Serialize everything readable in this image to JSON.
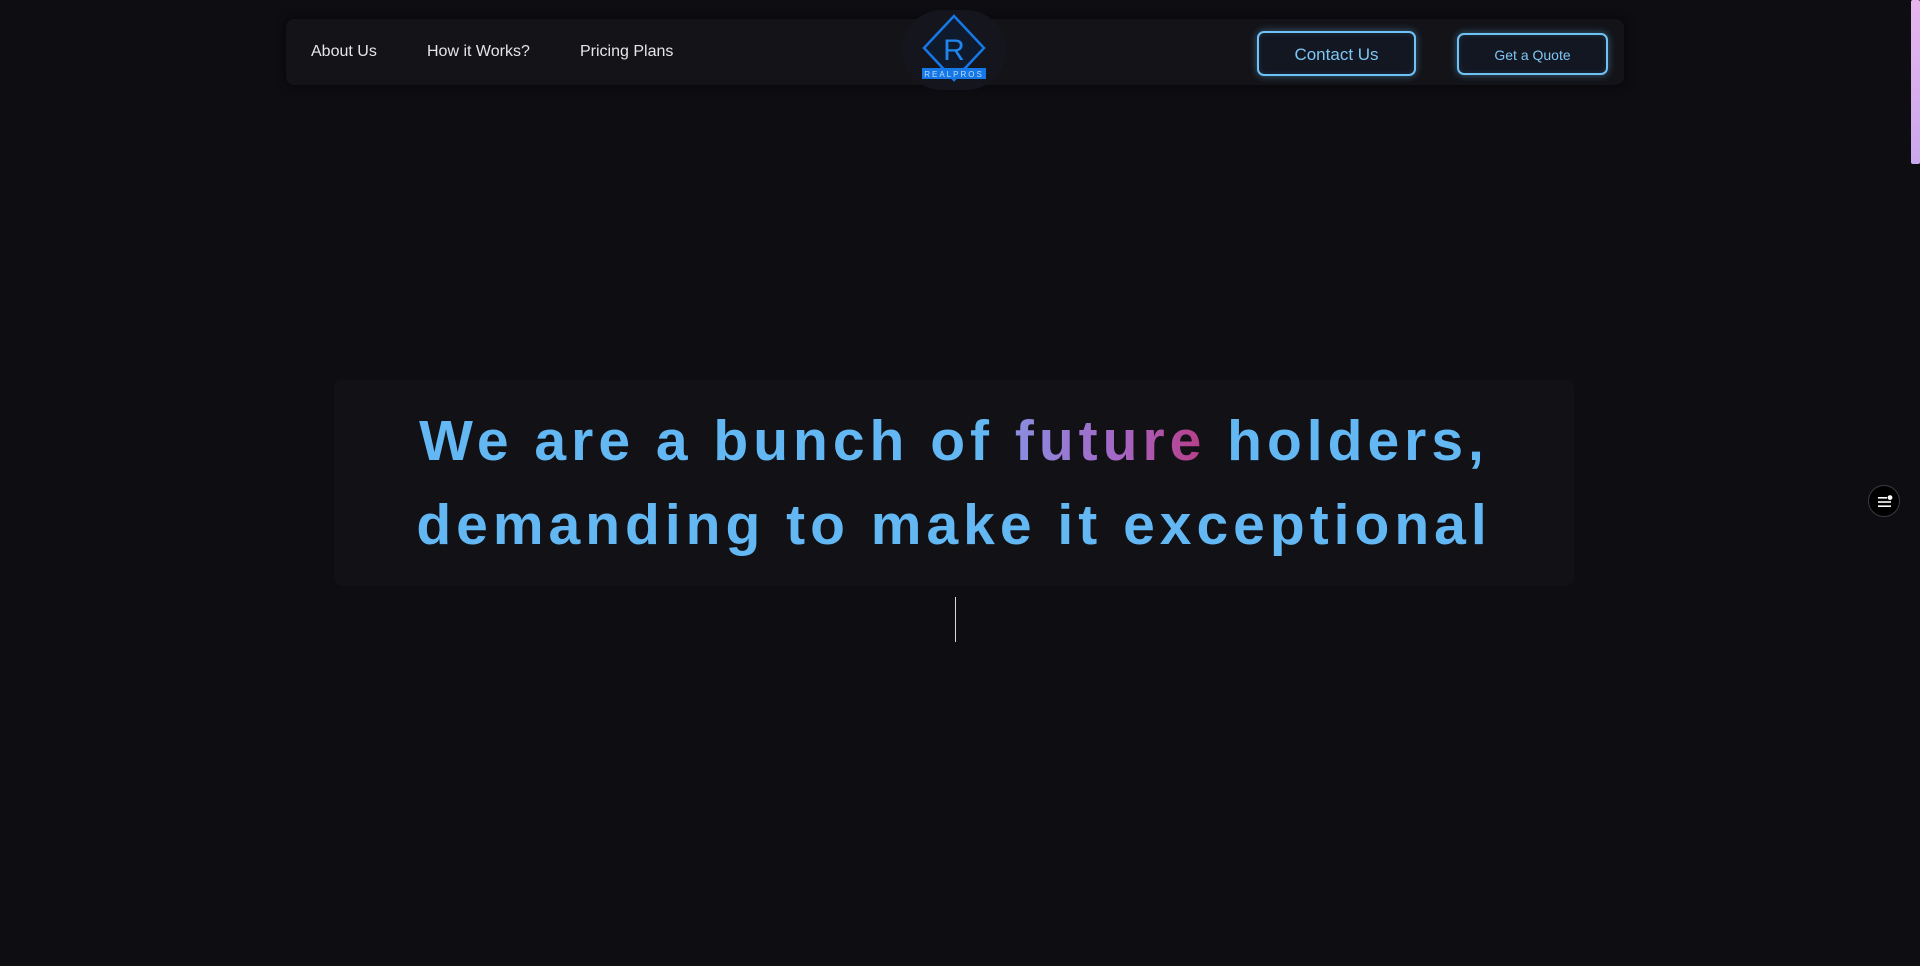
{
  "nav": {
    "links": [
      "About Us",
      "How it Works?",
      "Pricing Plans"
    ],
    "logo": {
      "letter": "R",
      "wordmark": "REALPROS"
    },
    "contact_label": "Contact Us",
    "quote_label": "Get a Quote"
  },
  "hero": {
    "line1_before": "We are a bunch of ",
    "line1_highlight": "future",
    "line1_after": " holders,",
    "line2": "demanding to make it exceptional"
  },
  "colors": {
    "background": "#0d0d12",
    "accent": "#63b8f4",
    "button_border": "#6ec2f5",
    "logo_blue": "#1677e6",
    "gradient": [
      "#8a8ee0",
      "#a566c4",
      "#b93d86"
    ]
  },
  "icons": {
    "side_menu": "menu-dot-icon"
  }
}
